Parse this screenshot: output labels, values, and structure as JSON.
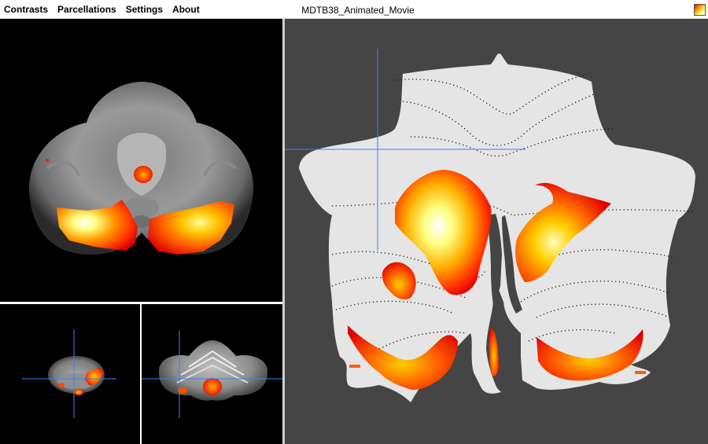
{
  "menubar": {
    "items": [
      "Contrasts",
      "Parcellations",
      "Settings",
      "About"
    ]
  },
  "window": {
    "title": "MDTB38_Animated_Movie"
  },
  "colormap": {
    "name": "hot",
    "colors": [
      "#ff0000",
      "#ff8a00",
      "#ffff66",
      "#ffffff"
    ]
  },
  "theme": {
    "flatmap_background": "#454545",
    "slice_background": "#000000",
    "crosshair_color": "#3b82f6",
    "cerebellum_surface": "#e6e6e6"
  },
  "views": [
    "axial-slice",
    "coronal-slice",
    "sagittal-slice",
    "flatmap"
  ]
}
